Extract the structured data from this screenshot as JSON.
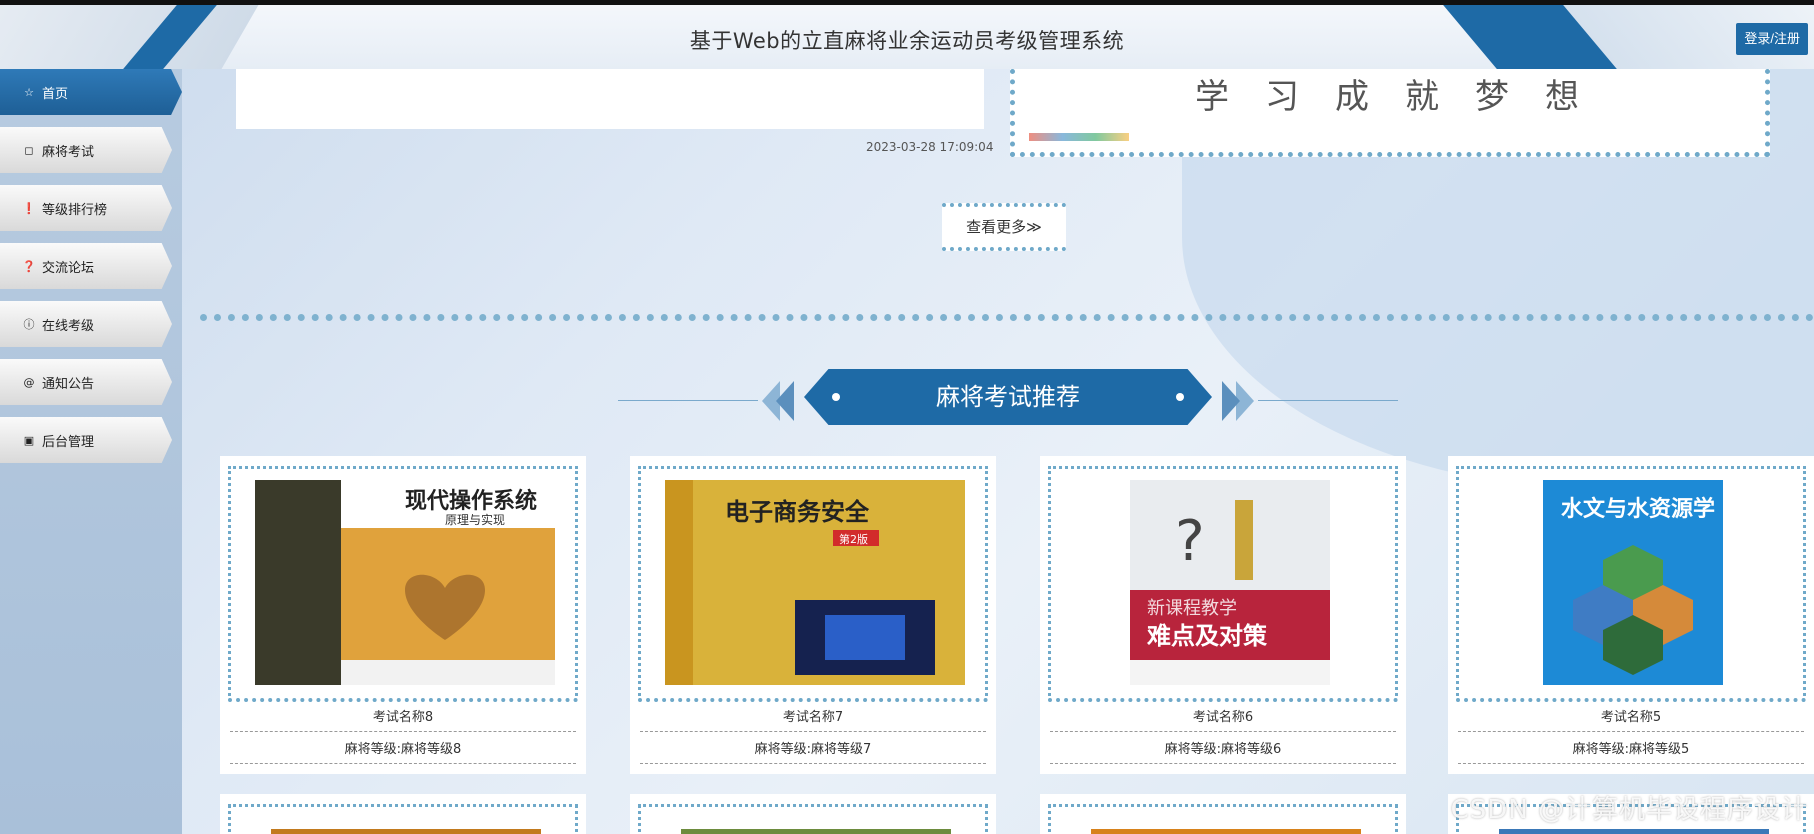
{
  "header": {
    "title": "基于Web的立直麻将业余运动员考级管理系统",
    "login_label": "登录/注册"
  },
  "sidebar": {
    "items": [
      {
        "label": "首页",
        "icon": "star-icon",
        "glyph": "☆",
        "active": true
      },
      {
        "label": "麻将考试",
        "icon": "bag-icon",
        "glyph": "◻",
        "active": false
      },
      {
        "label": "等级排行榜",
        "icon": "exclamation-circle-icon",
        "glyph": "❗",
        "active": false
      },
      {
        "label": "交流论坛",
        "icon": "question-circle-icon",
        "glyph": "❓",
        "active": false
      },
      {
        "label": "在线考级",
        "icon": "info-circle-icon",
        "glyph": "ⓘ",
        "active": false
      },
      {
        "label": "通知公告",
        "icon": "at-icon",
        "glyph": "@",
        "active": false
      },
      {
        "label": "后台管理",
        "icon": "calendar-icon",
        "glyph": "▣",
        "active": false
      }
    ]
  },
  "news": {
    "date": "2023-03-28 17:09:04",
    "banner_text": "学习成就梦想"
  },
  "more_label": "查看更多≫",
  "section": {
    "title": "麻将考试推荐"
  },
  "cards": [
    {
      "name": "考试名称8",
      "level": "麻将等级:麻将等级8",
      "cover_title": "现代操作系统",
      "cover_sub": "原理与实现",
      "cover_color": "#e0a23c"
    },
    {
      "name": "考试名称7",
      "level": "麻将等级:麻将等级7",
      "cover_title": "电子商务安全",
      "cover_sub": "第2版",
      "cover_color": "#d9b23a"
    },
    {
      "name": "考试名称6",
      "level": "麻将等级:麻将等级6",
      "cover_title": "新课程教学",
      "cover_sub": "难点及对策",
      "cover_color": "#b8243c"
    },
    {
      "name": "考试名称5",
      "level": "麻将等级:麻将等级5",
      "cover_title": "水文与水资源学",
      "cover_sub": "",
      "cover_color": "#1d8ad6"
    }
  ],
  "row2_colors": [
    "#c27a1e",
    "#6d8c3e",
    "#d7821c",
    "#3a78b8"
  ],
  "watermark": "CSDN @计算机毕设程序设计"
}
